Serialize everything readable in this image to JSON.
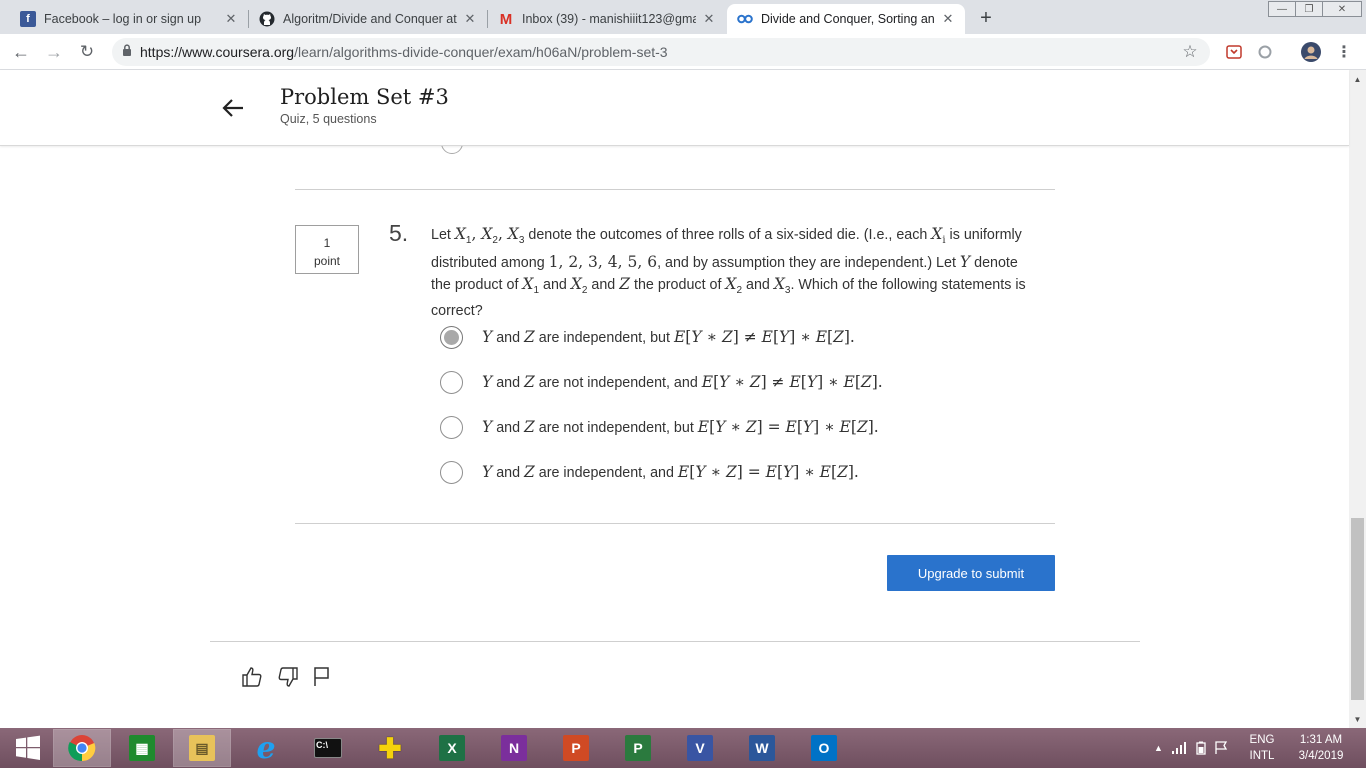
{
  "browser": {
    "tabs": [
      {
        "title": "Facebook – log in or sign up",
        "icon": "facebook-icon",
        "active": false
      },
      {
        "title": "Algoritm/Divide and Conquer at",
        "icon": "github-icon",
        "active": false
      },
      {
        "title": "Inbox (39) - manishiiit123@gmail",
        "icon": "gmail-icon",
        "active": false
      },
      {
        "title": "Divide and Conquer, Sorting and",
        "icon": "coursera-icon",
        "active": true
      }
    ],
    "new_tab": "+",
    "url_host": "https://www.coursera.org",
    "url_path": "/learn/algorithms-divide-conquer/exam/h06aN/problem-set-3"
  },
  "header": {
    "title": "Problem Set #3",
    "subtitle": "Quiz, 5 questions"
  },
  "question": {
    "points_value": "1",
    "points_label": "point",
    "number": "5."
  },
  "submit_label": "Upgrade to submit",
  "taskbar": {
    "apps": [
      "start",
      "chrome",
      "store",
      "file-explorer",
      "internet-explorer",
      "cmd",
      "app-plus",
      "excel",
      "onenote",
      "powerpoint",
      "project",
      "visio",
      "word",
      "outlook"
    ],
    "lang_top": "ENG",
    "lang_bottom": "INTL",
    "time": "1:31 AM",
    "date": "3/4/2019"
  },
  "colors": {
    "accent": "#2a73cc",
    "taskbar": "#7d5b6c"
  }
}
